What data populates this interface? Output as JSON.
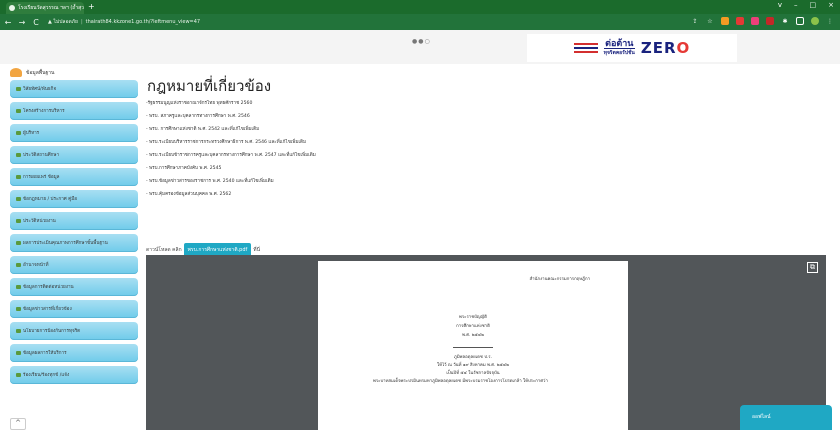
{
  "browser": {
    "tab_title": "โรงเรียนวัดสุวรรณ ฯลฯ (ถ้ำสุวรรณ) ×",
    "tab_close": "×",
    "new_tab": "+",
    "nav": {
      "back": "←",
      "forward": "→",
      "reload": "C"
    },
    "security_warning": "ไม่ปลอดภัย",
    "url": "thairath84.kkzone1.go.th/?leftmenu_view=47",
    "window_controls": [
      "v",
      "–",
      "□",
      "×"
    ],
    "extension_icons": [
      "share-icon",
      "star-icon",
      "ext-orange-icon",
      "ext-red-icon",
      "ext-pink-icon",
      "ext-red2-icon",
      "puzzle-icon",
      "panel-icon",
      "profile-icon",
      "menu-icon"
    ]
  },
  "banner": {
    "carousel_dots": "●●○",
    "logo_text": "ต่อต้าน",
    "logo_subtext": "ทุจริตคอรัปชั่น",
    "zero_logo": "ZER",
    "zero_logo_o": "O"
  },
  "sidebar": {
    "header": "ข้อมูลพื้นฐาน",
    "items": [
      {
        "label": "วิสัยทัศน์/พันธกิจ"
      },
      {
        "label": "โครงสร้างการบริหาร"
      },
      {
        "label": "ผู้บริหาร"
      },
      {
        "label": "ประวัติสถานศึกษา"
      },
      {
        "label": "การเผยแพร่ ข้อมูล"
      },
      {
        "label": "ข้อกฎหมาย / ประกาศ คู่มือ"
      },
      {
        "label": "ประวัติหน่วยงาน"
      },
      {
        "label": "ผลการประเมินคุณภาพการศึกษาขั้นพื้นฐาน"
      },
      {
        "label": "อำนาจหน้าที่"
      },
      {
        "label": "ข้อมูลการติดต่อหน่วยงาน"
      },
      {
        "label": "ข้อมูลข่าวสารที่เกี่ยวข้อง"
      },
      {
        "label": "นโยบายการป้องกันการทุจริต"
      },
      {
        "label": "ข้อมูลผลการให้บริการ"
      },
      {
        "label": "ร้องเรียน/ร้องทุกข์ /แจ้ง"
      }
    ]
  },
  "main": {
    "title": "กฎหมายที่เกี่ยวข้อง",
    "laws": [
      "-รัฐธรรมนูญแห่งราชอาณาจักรไทย พุทธศักราช 2560",
      "- พรบ. สภาครูและบุคลากรทางการศึกษา พ.ศ. 2546",
      "- พรบ. การศึกษาแห่งชาติ พ.ศ. 2542 และที่แก้ไขเพิ่มเติม",
      "- พรบ.ระเบียบบริหารราชการกระทรวงศึกษาธิการ พ.ศ. 2546 และที่แก้ไขเพิ่มเติม",
      "- พรบ.ระเบียบข้าราชการครูและบุคลากรทางการศึกษา พ.ศ. 2547 และที่แก้ไขเพิ่มเติม",
      "- พรบ.การศึกษาภาคบังคับ พ.ศ. 2545",
      "- พรบ.ข้อมูลข่าวสารของราชการ พ.ศ. 2540 และที่แก้ไขเพิ่มเติม",
      "- พรบ.คุ้มครองข้อมูลส่วนบุคคล พ.ศ. 2562"
    ],
    "download_prefix": "ดาวน์โหลด คลิก",
    "download_button": "พรบ.การศึกษาแห่งชาติ.pdf",
    "download_suffix": "ที่นี่"
  },
  "pdf": {
    "agency": "สำนักงานคณะกรรมการกฤษฎีกา",
    "doc_title": "พระราชบัญญัติ",
    "doc_name": "การศึกษาแห่งชาติ",
    "doc_year": "พ.ศ. ๒๕๔๒",
    "king": "ภูมิพลอดุลยเดช ป.ร.",
    "given": "ให้ไว้ ณ วันที่ ๑๙ สิงหาคม พ.ศ. ๒๕๔๒",
    "reign": "เป็นปีที่ ๕๔ ในรัชกาลปัจจุบัน",
    "body": "พระบาทสมเด็จพระปรมินทรมหาภูมิพลอดุลยเดช มีพระบรมราชโองการโปรดเกล้า ให้ประกาศว่า"
  },
  "chat_button": "ออฟไลน์",
  "scroll_top": "^"
}
